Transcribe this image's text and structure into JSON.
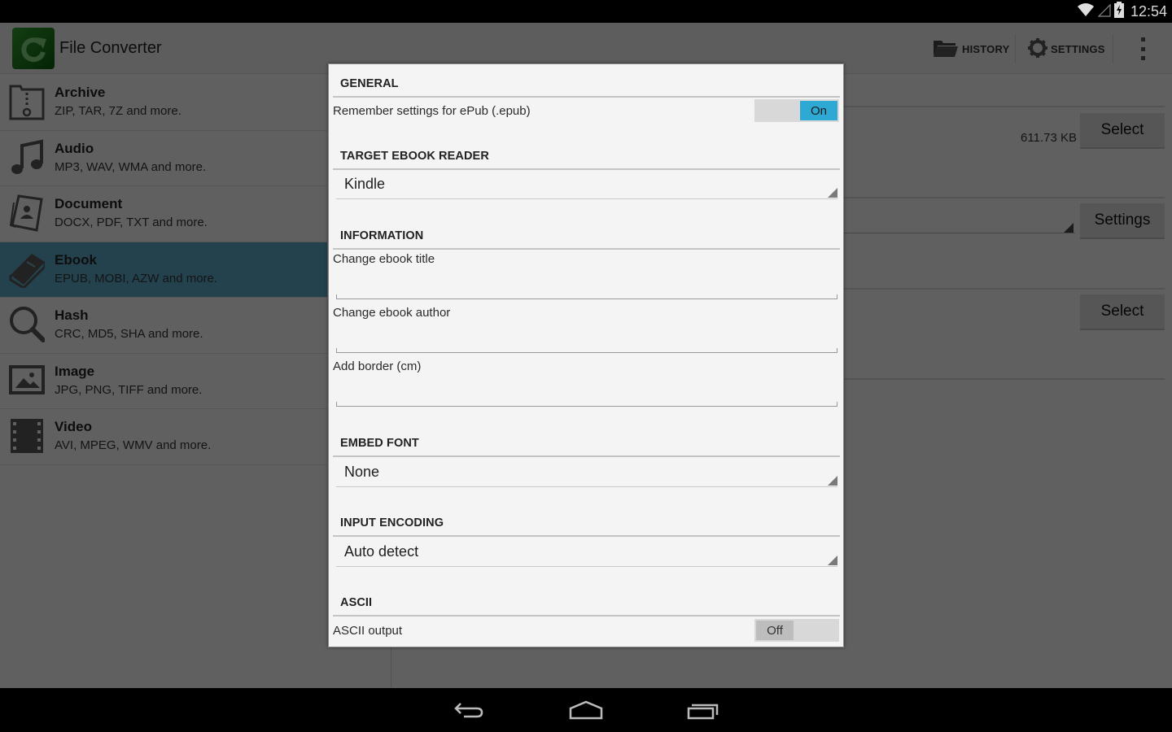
{
  "status_bar": {
    "time": "12:54",
    "icons": [
      "wifi-icon",
      "cell-signal-icon",
      "battery-charging-icon"
    ]
  },
  "action_bar": {
    "app_title": "File Converter",
    "app_icon": "refresh-arrow-icon",
    "history_label": "HISTORY",
    "settings_label": "SETTINGS"
  },
  "sidebar": {
    "items": [
      {
        "title": "Archive",
        "subtitle": "ZIP, TAR, 7Z and more.",
        "icon": "archive-icon",
        "active": false
      },
      {
        "title": "Audio",
        "subtitle": "MP3, WAV, WMA and more.",
        "icon": "music-note-icon",
        "active": false
      },
      {
        "title": "Document",
        "subtitle": "DOCX, PDF, TXT and more.",
        "icon": "document-icon",
        "active": false
      },
      {
        "title": "Ebook",
        "subtitle": "EPUB, MOBI, AZW and more.",
        "icon": "book-icon",
        "active": true
      },
      {
        "title": "Hash",
        "subtitle": "CRC, MD5, SHA and more.",
        "icon": "magnifier-icon",
        "active": false
      },
      {
        "title": "Image",
        "subtitle": "JPG, PNG, TIFF and more.",
        "icon": "picture-icon",
        "active": false
      },
      {
        "title": "Video",
        "subtitle": "AVI, MPEG, WMV and more.",
        "icon": "film-icon",
        "active": false
      }
    ]
  },
  "main_panel": {
    "file_size": "611.73 KB",
    "select_file_label": "Select",
    "settings_label": "Settings",
    "select_output_label": "Select"
  },
  "dialog": {
    "general": {
      "header": "GENERAL",
      "remember_label": "Remember settings for ePub (.epub)",
      "remember_state": "On"
    },
    "target_reader": {
      "header": "TARGET EBOOK READER",
      "value": "Kindle"
    },
    "information": {
      "header": "INFORMATION",
      "title_label": "Change ebook title",
      "title_value": "",
      "author_label": "Change ebook author",
      "author_value": "",
      "border_label": "Add border (cm)",
      "border_value": ""
    },
    "embed_font": {
      "header": "EMBED FONT",
      "value": "None"
    },
    "input_encoding": {
      "header": "INPUT ENCODING",
      "value": "Auto detect"
    },
    "ascii": {
      "header": "ASCII",
      "output_label": "ASCII output",
      "output_state": "Off"
    }
  },
  "nav_bar": {
    "buttons": [
      "back-icon",
      "home-icon",
      "recent-apps-icon"
    ]
  },
  "colors": {
    "accent": "#2ea9d3",
    "active_item": "#5aa5c1",
    "dialog_bg": "#f4f4f4"
  }
}
